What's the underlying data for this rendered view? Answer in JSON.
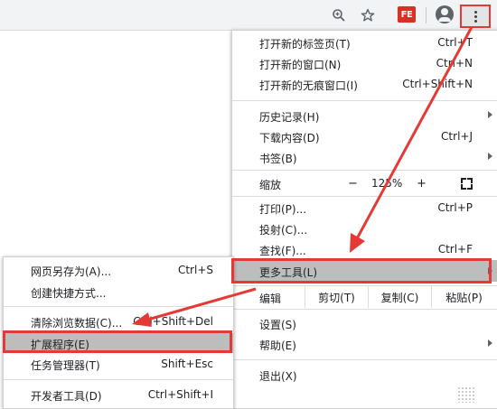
{
  "main_menu": {
    "new_tab": {
      "label": "打开新的标签页(T)",
      "shortcut": "Ctrl+T"
    },
    "new_window": {
      "label": "打开新的窗口(N)",
      "shortcut": "Ctrl+N"
    },
    "new_incognito": {
      "label": "打开新的无痕窗口(I)",
      "shortcut": "Ctrl+Shift+N"
    },
    "history": {
      "label": "历史记录(H)"
    },
    "downloads": {
      "label": "下载内容(D)",
      "shortcut": "Ctrl+J"
    },
    "bookmarks": {
      "label": "书签(B)"
    },
    "zoom": {
      "label": "缩放",
      "minus": "−",
      "level": "125%",
      "plus": "+"
    },
    "print": {
      "label": "打印(P)...",
      "shortcut": "Ctrl+P"
    },
    "cast": {
      "label": "投射(C)..."
    },
    "find": {
      "label": "查找(F)...",
      "shortcut": "Ctrl+F"
    },
    "more_tools": {
      "label": "更多工具(L)"
    },
    "edit": {
      "label": "编辑",
      "cut": "剪切(T)",
      "copy": "复制(C)",
      "paste": "粘贴(P)"
    },
    "settings": {
      "label": "设置(S)"
    },
    "help": {
      "label": "帮助(E)"
    },
    "exit": {
      "label": "退出(X)"
    }
  },
  "sub_menu": {
    "save_page": {
      "label": "网页另存为(A)...",
      "shortcut": "Ctrl+S"
    },
    "create_shortcut": {
      "label": "创建快捷方式..."
    },
    "clear_data": {
      "label": "清除浏览数据(C)...",
      "shortcut": "Ctrl+Shift+Del"
    },
    "extensions": {
      "label": "扩展程序(E)"
    },
    "task_manager": {
      "label": "任务管理器(T)",
      "shortcut": "Shift+Esc"
    },
    "dev_tools": {
      "label": "开发者工具(D)",
      "shortcut": "Ctrl+Shift+I"
    }
  },
  "toolbar": {
    "fe_badge": "FE"
  },
  "colors": {
    "highlight": "#e53935",
    "selected_bg": "#bdbdbd"
  }
}
